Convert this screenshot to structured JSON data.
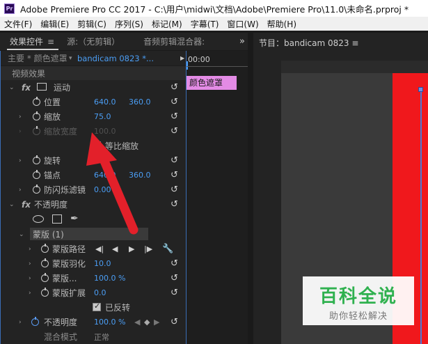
{
  "window": {
    "app_icon": "Pr",
    "title": "Adobe Premiere Pro CC 2017 - C:\\用户\\midwi\\文档\\Adobe\\Premiere Pro\\11.0\\未命名.prproj *"
  },
  "menu": [
    "文件(F)",
    "编辑(E)",
    "剪辑(C)",
    "序列(S)",
    "标记(M)",
    "字幕(T)",
    "窗口(W)",
    "帮助(H)"
  ],
  "left_panel": {
    "tabs": {
      "effect_controls": "效果控件",
      "menu_icon": "≡",
      "source": "源:（无剪辑）",
      "audio_mixer": "音频剪辑混合器:",
      "more": "»"
    },
    "source_bar": {
      "master": "主要 * 颜色遮罩",
      "clip": "bandicam 0823 *..."
    },
    "video_effects_label": "视频效果",
    "motion": {
      "label": "运动",
      "position": {
        "label": "位置",
        "x": "640.0",
        "y": "360.0"
      },
      "scale": {
        "label": "缩放",
        "value": "75.0"
      },
      "scale_width": {
        "label": "缩放宽度",
        "value": "100.0"
      },
      "uniform_scale": {
        "label": "等比缩放"
      },
      "rotation": {
        "label": "旋转"
      },
      "anchor": {
        "label": "锚点",
        "x": "640.0",
        "y": "360.0"
      },
      "anti_flicker": {
        "label": "防闪烁滤镜",
        "value": "0.00"
      }
    },
    "opacity": {
      "label": "不透明度",
      "mask": {
        "label": "蒙版 (1)",
        "path": {
          "label": "蒙版路径"
        },
        "feather": {
          "label": "蒙版羽化",
          "value": "10.0"
        },
        "mask_opacity": {
          "label": "蒙版...",
          "value": "100.0 %"
        },
        "expansion": {
          "label": "蒙版扩展",
          "value": "0.0"
        },
        "inverted": {
          "label": "已反转"
        }
      },
      "opacity_value": {
        "label": "不透明度",
        "value": "100.0 %"
      },
      "blend_mode": {
        "label": "混合模式",
        "value": "正常"
      }
    },
    "timeline": {
      "time": "00:00",
      "clip_label": "颜色遮罩"
    }
  },
  "right_panel": {
    "program_tab": "节目：bandicam 0823 ≡"
  },
  "watermark": {
    "main": "百科全说",
    "sub": "助你轻松解决"
  },
  "colors": {
    "accent_blue": "#4b9ef5",
    "clip_pink": "#e38be5",
    "red_matte": "#f0181c",
    "arrow_red": "#e3202a",
    "watermark_green": "#2fb14f"
  }
}
